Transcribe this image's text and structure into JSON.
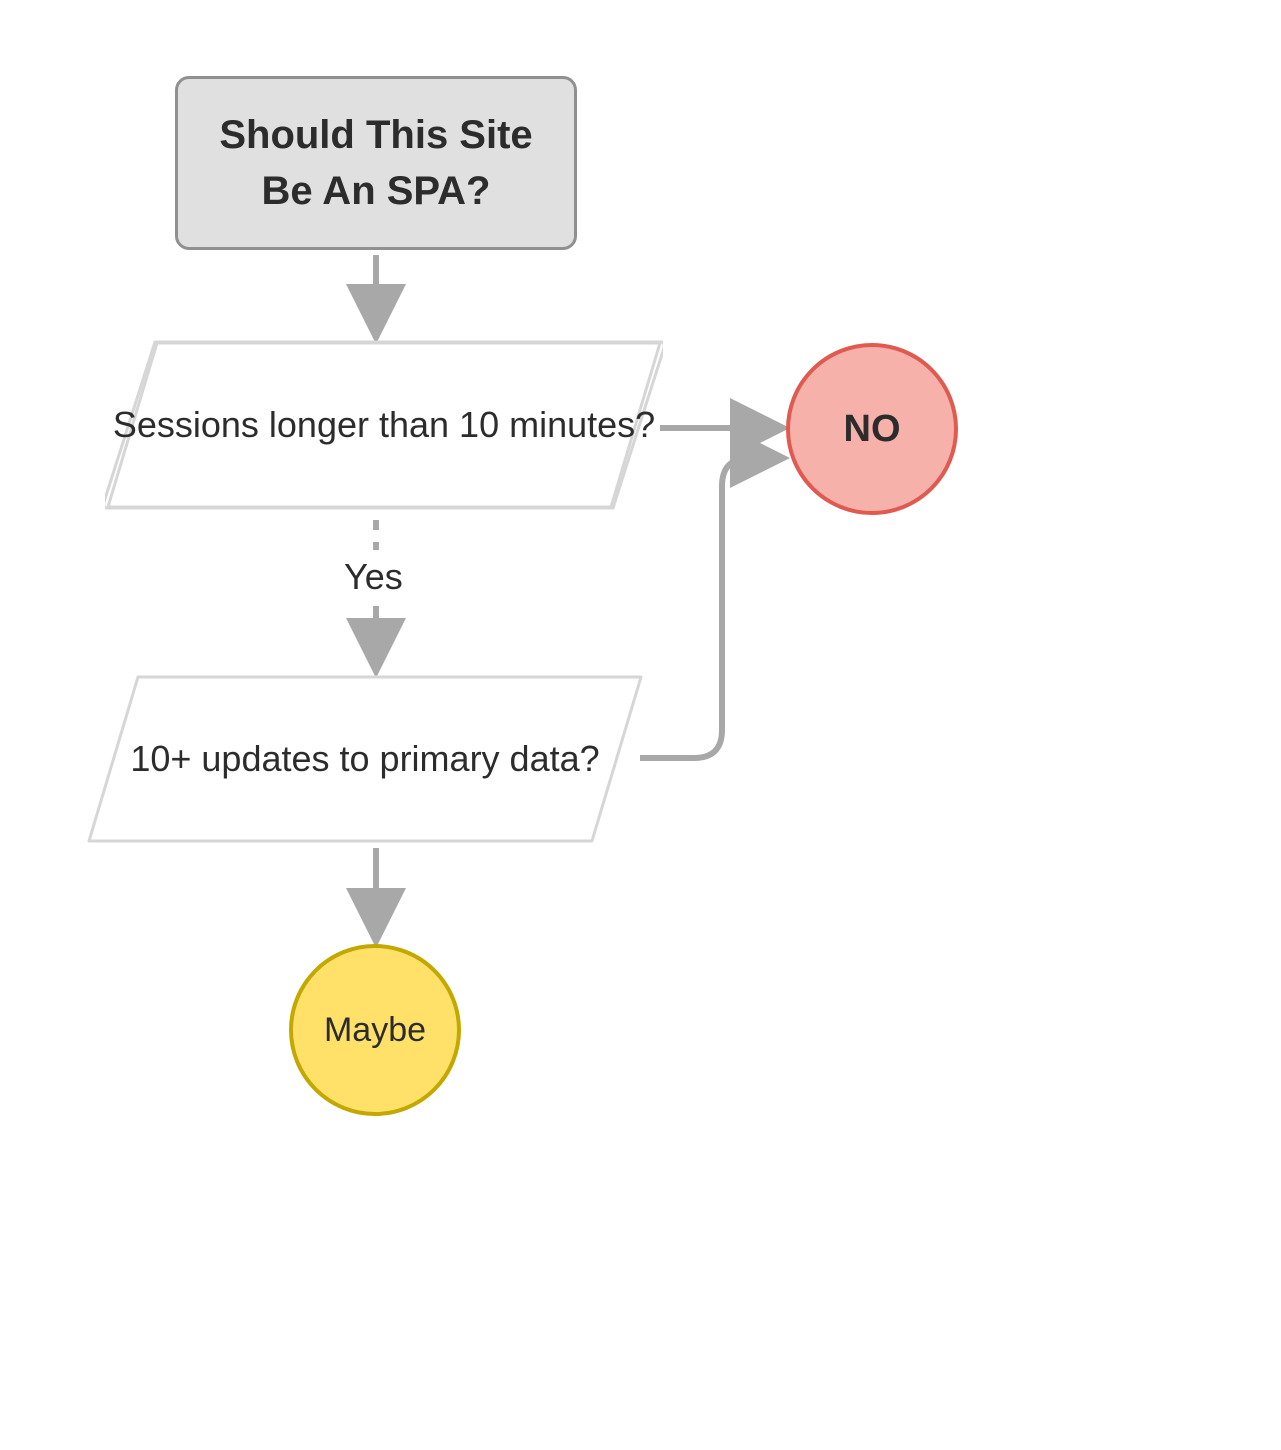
{
  "diagram": {
    "title": "Should This Site Be An SPA?",
    "decisions": {
      "d1": "Sessions longer than 10 minutes?",
      "d2": "10+ updates to primary data?"
    },
    "outcomes": {
      "no": "NO",
      "maybe": "Maybe"
    },
    "edge_labels": {
      "yes": "Yes"
    }
  },
  "colors": {
    "title_fill": "#e0e0e0",
    "title_border": "#909090",
    "node_border": "#d0d0d0",
    "no_fill": "#f7b1ab",
    "no_border": "#e05a4f",
    "maybe_fill": "#ffe169",
    "maybe_border": "#c2a800",
    "arrow": "#a8a8a8",
    "text": "#2c2c2c"
  }
}
